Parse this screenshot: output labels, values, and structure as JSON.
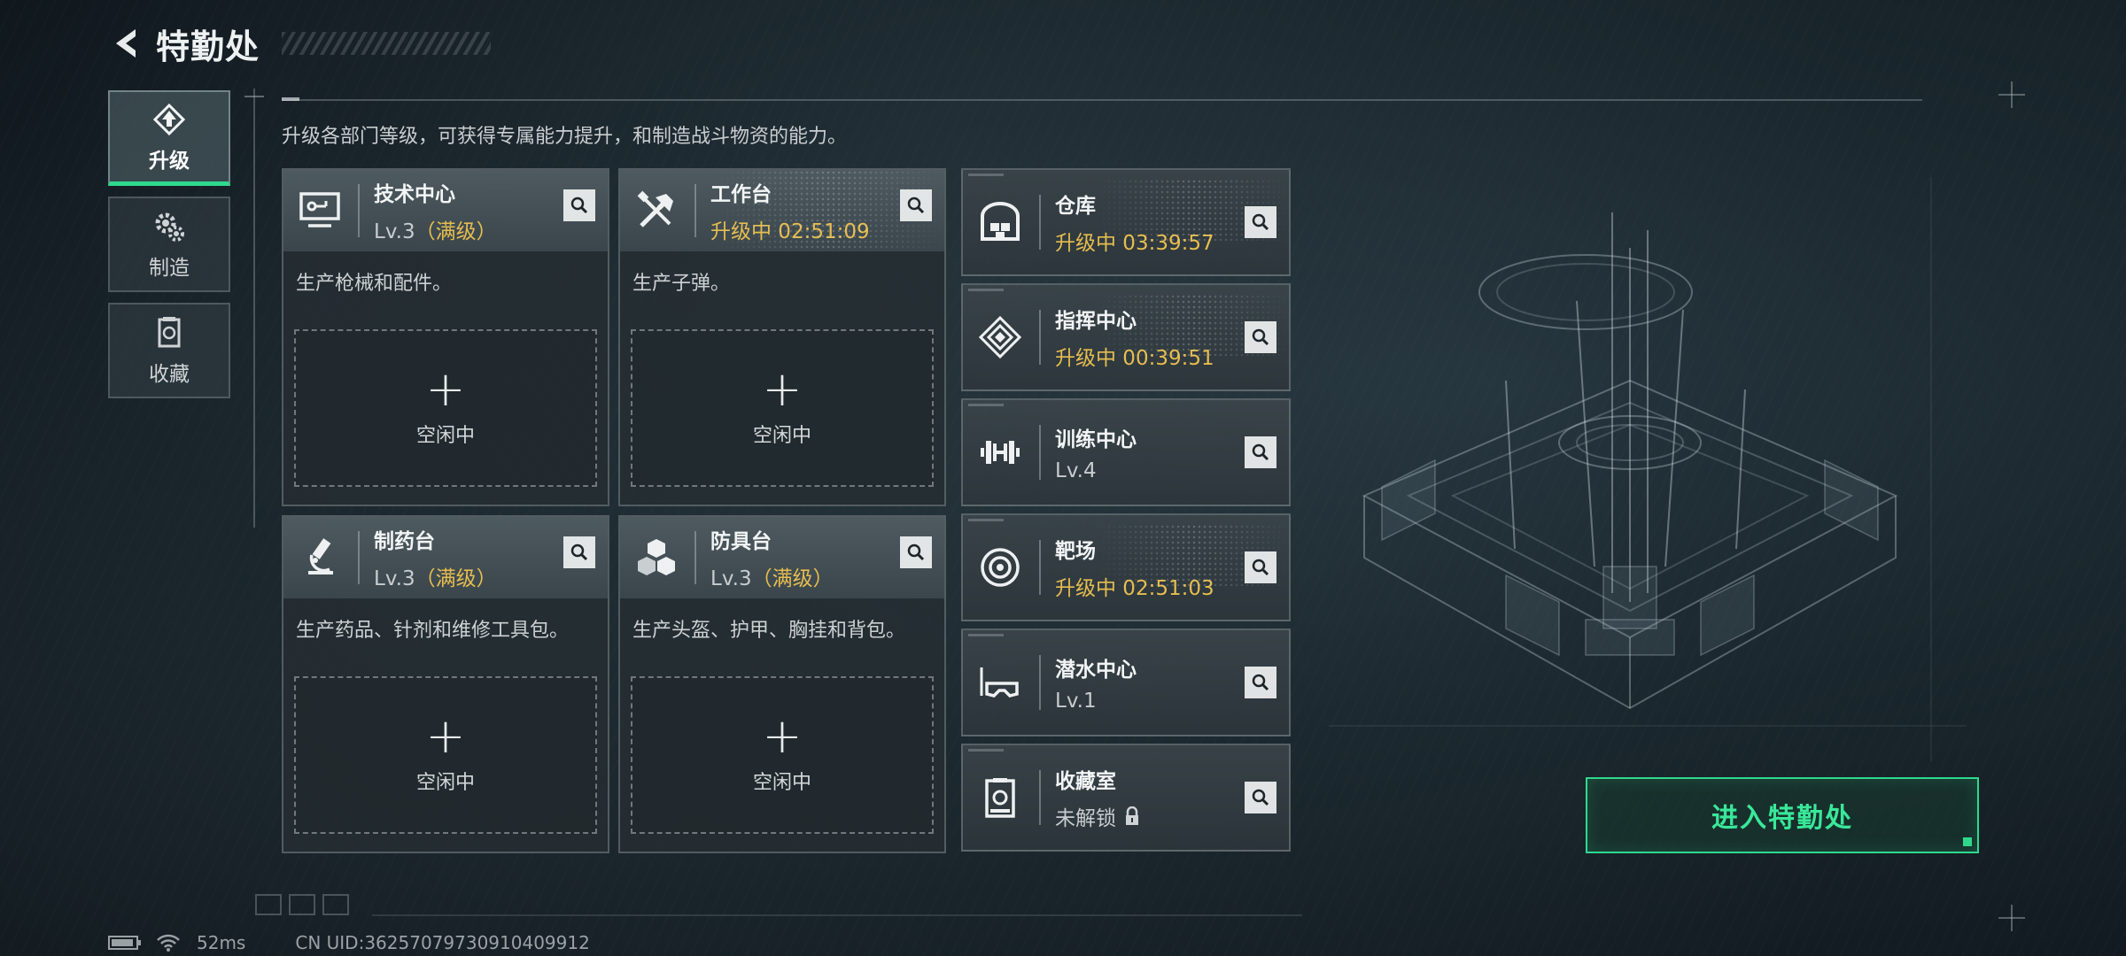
{
  "header": {
    "title": "特勤处"
  },
  "tabs": [
    {
      "label": "升级",
      "icon": "upgrade-icon",
      "active": true
    },
    {
      "label": "制造",
      "icon": "gears-icon",
      "active": false
    },
    {
      "label": "收藏",
      "icon": "collection-icon",
      "active": false
    }
  ],
  "description": "升级各部门等级，可获得专属能力提升，和制造战斗物资的能力。",
  "cards": [
    {
      "name": "技术中心",
      "level": "Lv.3",
      "tag": "（满级）",
      "desc": "生产枪械和配件。",
      "slot_label": "空闲中",
      "icon": "monitor-icon"
    },
    {
      "name": "工作台",
      "status": "升级中 02:51:09",
      "desc": "生产子弹。",
      "slot_label": "空闲中",
      "icon": "tools-icon"
    },
    {
      "name": "制药台",
      "level": "Lv.3",
      "tag": "（满级）",
      "desc": "生产药品、针剂和维修工具包。",
      "slot_label": "空闲中",
      "icon": "microscope-icon"
    },
    {
      "name": "防具台",
      "level": "Lv.3",
      "tag": "（满级）",
      "desc": "生产头盔、护甲、胸挂和背包。",
      "slot_label": "空闲中",
      "icon": "armor-boxes-icon"
    }
  ],
  "list": [
    {
      "name": "仓库",
      "status": "升级中 03:39:57",
      "upgrading": true,
      "icon": "warehouse-icon"
    },
    {
      "name": "指挥中心",
      "status": "升级中 00:39:51",
      "upgrading": true,
      "icon": "command-icon"
    },
    {
      "name": "训练中心",
      "status": "Lv.4",
      "upgrading": false,
      "icon": "dumbbell-icon"
    },
    {
      "name": "靶场",
      "status": "升级中 02:51:03",
      "upgrading": true,
      "icon": "target-icon"
    },
    {
      "name": "潜水中心",
      "status": "Lv.1",
      "upgrading": false,
      "icon": "diving-mask-icon"
    },
    {
      "name": "收藏室",
      "status": "未解锁",
      "upgrading": false,
      "locked": true,
      "icon": "vault-icon"
    }
  ],
  "enter_button": "进入特勤处",
  "status_bar": {
    "ping": "52ms",
    "uid": "CN UID:36257079730910409912"
  },
  "colors": {
    "accent": "#2ed98e",
    "upgrading": "#e6bd4f"
  }
}
